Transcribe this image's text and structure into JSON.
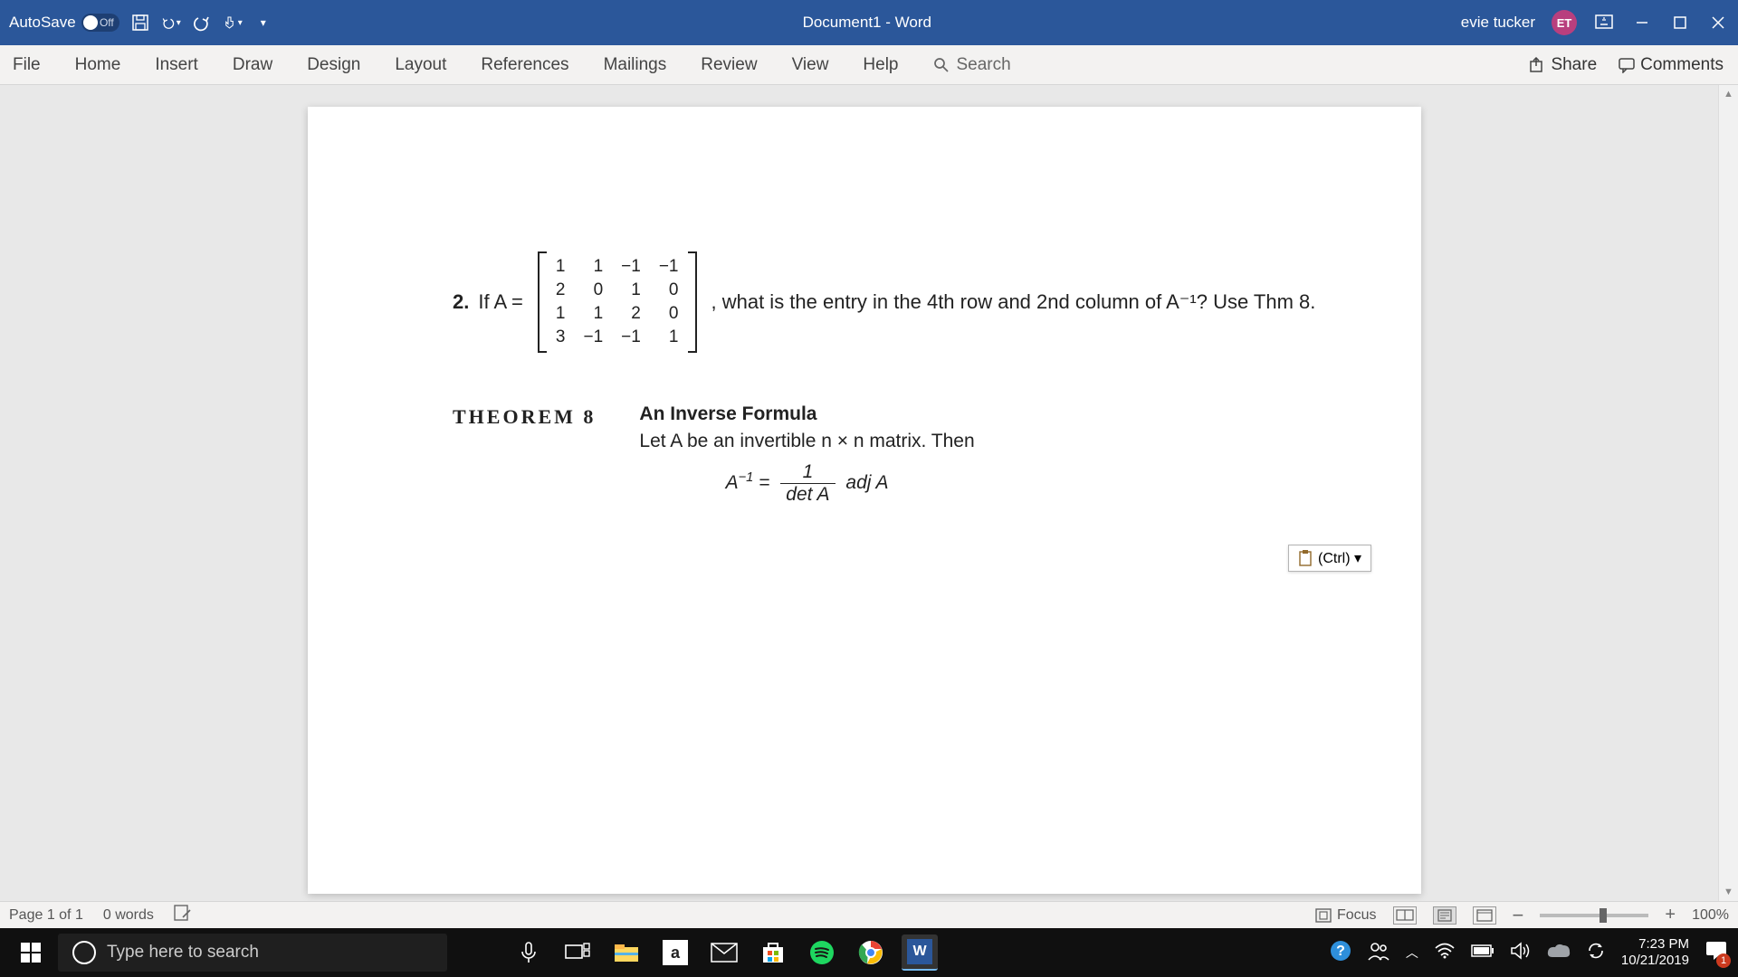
{
  "title_bar": {
    "autosave_label": "AutoSave",
    "autosave_state": "Off",
    "document_title": "Document1  -  Word",
    "user_name": "evie tucker",
    "user_initials": "ET"
  },
  "ribbon": {
    "tabs": [
      "File",
      "Home",
      "Insert",
      "Draw",
      "Design",
      "Layout",
      "References",
      "Mailings",
      "Review",
      "View",
      "Help"
    ],
    "search_placeholder": "Search",
    "share_label": "Share",
    "comments_label": "Comments"
  },
  "document": {
    "problem_number": "2.",
    "problem_prefix": "If A =",
    "matrix": [
      [
        "1",
        "1",
        "−1",
        "−1"
      ],
      [
        "2",
        "0",
        "1",
        "0"
      ],
      [
        "1",
        "1",
        "2",
        "0"
      ],
      [
        "3",
        "−1",
        "−1",
        "1"
      ]
    ],
    "problem_suffix": ", what is the entry in the 4th row and 2nd column of A⁻¹? Use Thm 8.",
    "theorem_label": "THEOREM 8",
    "theorem_title": "An Inverse Formula",
    "theorem_text": "Let A be an invertible n × n matrix. Then",
    "formula_lhs": "A",
    "formula_exp": "−1",
    "formula_eq": " = ",
    "formula_num": "1",
    "formula_den": "det A",
    "formula_rhs": " adj A",
    "paste_options": "(Ctrl) ▾"
  },
  "status_bar": {
    "page_info": "Page 1 of 1",
    "word_count": "0 words",
    "focus_label": "Focus",
    "zoom_label": "100%"
  },
  "taskbar": {
    "search_placeholder": "Type here to search",
    "time": "7:23 PM",
    "date": "10/21/2019",
    "notif_count": "1"
  }
}
